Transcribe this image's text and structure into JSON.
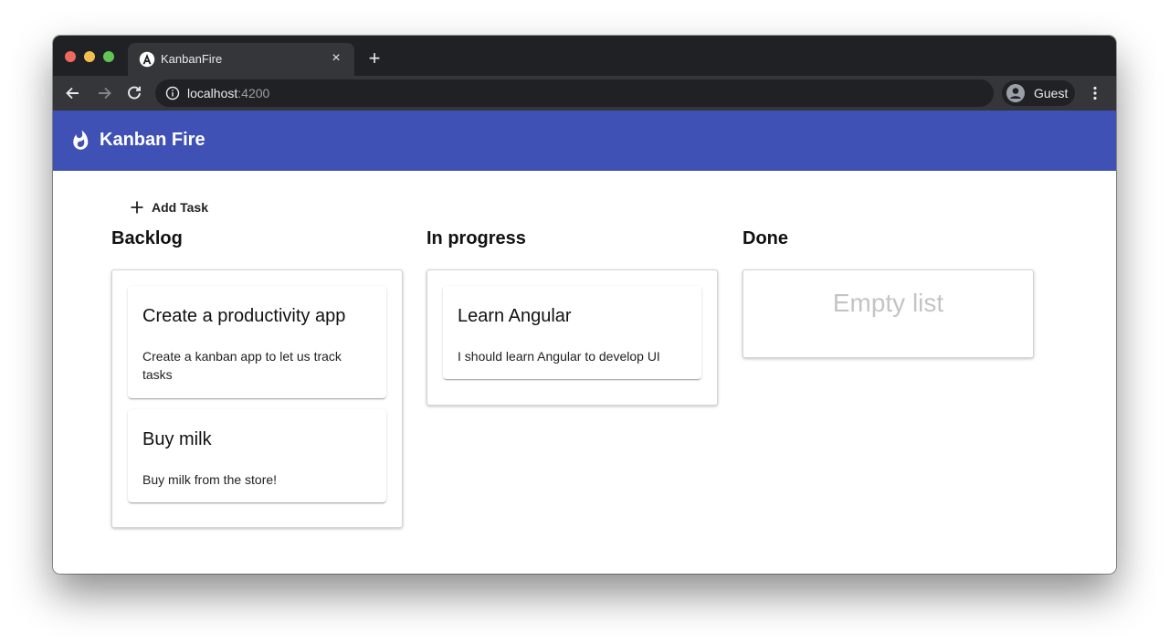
{
  "browser": {
    "tab_title": "KanbanFire",
    "tab_close": "×",
    "new_tab": "+",
    "url_host": "localhost",
    "url_port": ":4200",
    "profile_label": "Guest"
  },
  "app": {
    "title": "Kanban Fire",
    "brand_color": "#3f51b5",
    "add_task_label": "Add Task"
  },
  "columns": [
    {
      "title": "Backlog",
      "tasks": [
        {
          "title": "Create a productivity app",
          "description": "Create a kanban app to let us track tasks"
        },
        {
          "title": "Buy milk",
          "description": "Buy milk from the store!"
        }
      ]
    },
    {
      "title": "In progress",
      "tasks": [
        {
          "title": "Learn Angular",
          "description": "I should learn Angular to develop UI"
        }
      ]
    },
    {
      "title": "Done",
      "empty_label": "Empty list",
      "tasks": []
    }
  ]
}
